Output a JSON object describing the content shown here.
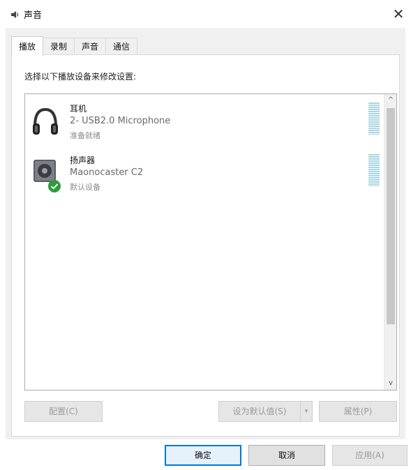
{
  "window": {
    "title": "声音",
    "close_symbol": "✕"
  },
  "tabs": [
    {
      "label": "播放",
      "active": true
    },
    {
      "label": "录制",
      "active": false
    },
    {
      "label": "声音",
      "active": false
    },
    {
      "label": "通信",
      "active": false
    }
  ],
  "instruction": "选择以下播放设备来修改设置:",
  "devices": [
    {
      "name": "耳机",
      "description": "2- USB2.0 Microphone",
      "status": "准备就绪",
      "icon": "headphones-icon",
      "default": false
    },
    {
      "name": "扬声器",
      "description": "Maonocaster C2",
      "status": "默认设备",
      "icon": "speaker-icon",
      "default": true
    }
  ],
  "scrollbar": {
    "up": "^",
    "down": "v"
  },
  "buttons": {
    "configure": "配置(C)",
    "set_default": "设为默认值(S)",
    "set_default_arrow": "▾",
    "properties": "属性(P)",
    "ok": "确定",
    "cancel": "取消",
    "apply": "应用(A)"
  },
  "colors": {
    "accent": "#0078d7",
    "check_green": "#2e9b3d",
    "meter": "#a9d6e2"
  }
}
